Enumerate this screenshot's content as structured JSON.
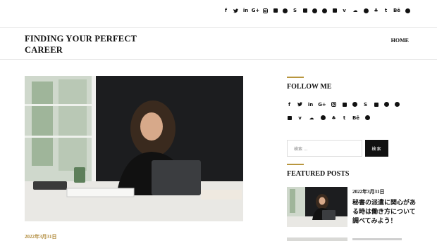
{
  "social_icons": [
    "facebook-icon",
    "twitter-icon",
    "linkedin-icon",
    "google-plus-icon",
    "instagram-icon",
    "flickr-icon",
    "github-icon",
    "scribd-icon",
    "slideshare-icon",
    "pinterest-icon",
    "wordpress-icon",
    "youtube-icon",
    "vimeo-icon",
    "soundcloud-icon",
    "spotify-icon",
    "snapchat-icon",
    "tumblr-icon",
    "behance-icon",
    "dribbble-icon"
  ],
  "social_glyphs": {
    "facebook": "f",
    "twitter": "t",
    "linkedin": "in",
    "google": "G+",
    "tumblr": "t",
    "behance": "Bē",
    "vimeo": "v"
  },
  "header": {
    "site_title": "FINDING YOUR PERFECT CAREER",
    "nav_home": "HOME"
  },
  "main": {
    "post_date": "2022年3月31日"
  },
  "sidebar": {
    "follow_title": "FOLLOW ME",
    "search_placeholder": "検索 ...",
    "search_button": "検索",
    "featured_title": "FEATURED POSTS",
    "featured_posts": [
      {
        "date": "2022年3月31日",
        "title": "秘書の派遣に関心がある時は働き方について調べてみよう！"
      }
    ]
  },
  "colors": {
    "accent": "#b8963e",
    "text": "#111111"
  }
}
